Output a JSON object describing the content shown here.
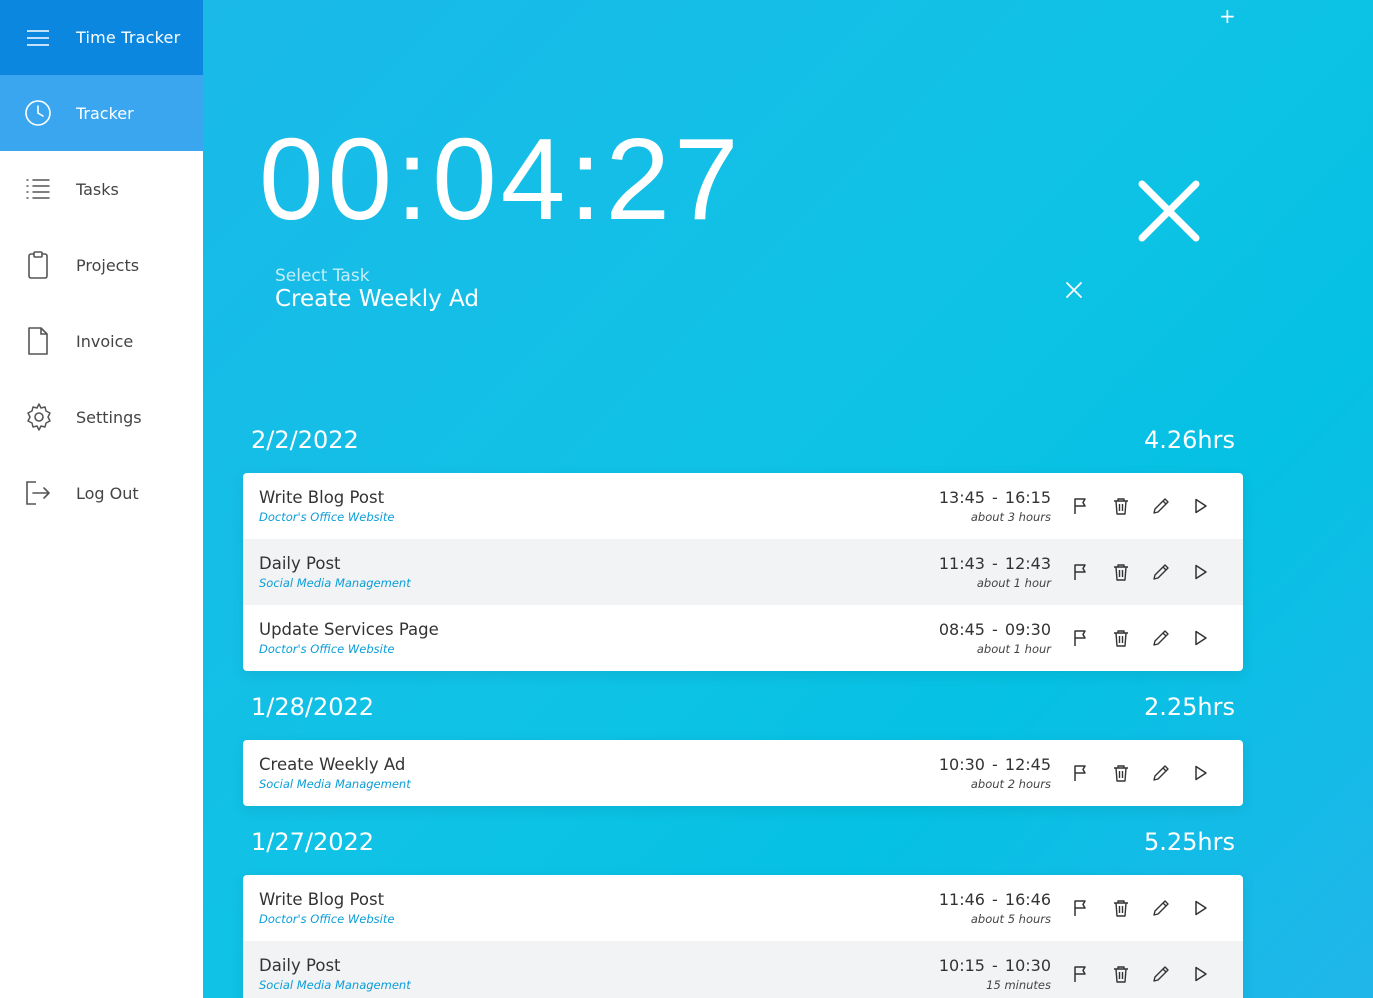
{
  "app": {
    "title": "Time Tracker"
  },
  "sidebar": {
    "items": [
      {
        "label": "Tracker",
        "icon": "clock-icon"
      },
      {
        "label": "Tasks",
        "icon": "list-icon"
      },
      {
        "label": "Projects",
        "icon": "clipboard-icon"
      },
      {
        "label": "Invoice",
        "icon": "file-icon"
      },
      {
        "label": "Settings",
        "icon": "gear-icon"
      },
      {
        "label": "Log Out",
        "icon": "logout-icon"
      }
    ]
  },
  "timer": {
    "display": "00:04:27",
    "task_label": "Select Task",
    "task_value": "Create Weekly Ad"
  },
  "days": [
    {
      "date": "2/2/2022",
      "total": "4.26hrs",
      "entries": [
        {
          "name": "Write Blog Post",
          "project": "Doctor's Office Website",
          "range": "13:45  -  16:15",
          "duration": "about 3 hours"
        },
        {
          "name": "Daily Post",
          "project": "Social Media Management",
          "range": "11:43  -  12:43",
          "duration": "about 1 hour"
        },
        {
          "name": "Update Services Page",
          "project": "Doctor's Office Website",
          "range": "08:45  -  09:30",
          "duration": "about 1 hour"
        }
      ]
    },
    {
      "date": "1/28/2022",
      "total": "2.25hrs",
      "entries": [
        {
          "name": "Create Weekly Ad",
          "project": "Social Media Management",
          "range": "10:30  -  12:45",
          "duration": "about 2 hours"
        }
      ]
    },
    {
      "date": "1/27/2022",
      "total": "5.25hrs",
      "entries": [
        {
          "name": "Write Blog Post",
          "project": "Doctor's Office Website",
          "range": "11:46  -  16:46",
          "duration": "about 5 hours"
        },
        {
          "name": "Daily Post",
          "project": "Social Media Management",
          "range": "10:15  -  10:30",
          "duration": "15 minutes"
        }
      ]
    }
  ],
  "colors": {
    "brand": "#0b87e0",
    "active": "#3ba6f0",
    "accent": "#0b9ed8"
  }
}
